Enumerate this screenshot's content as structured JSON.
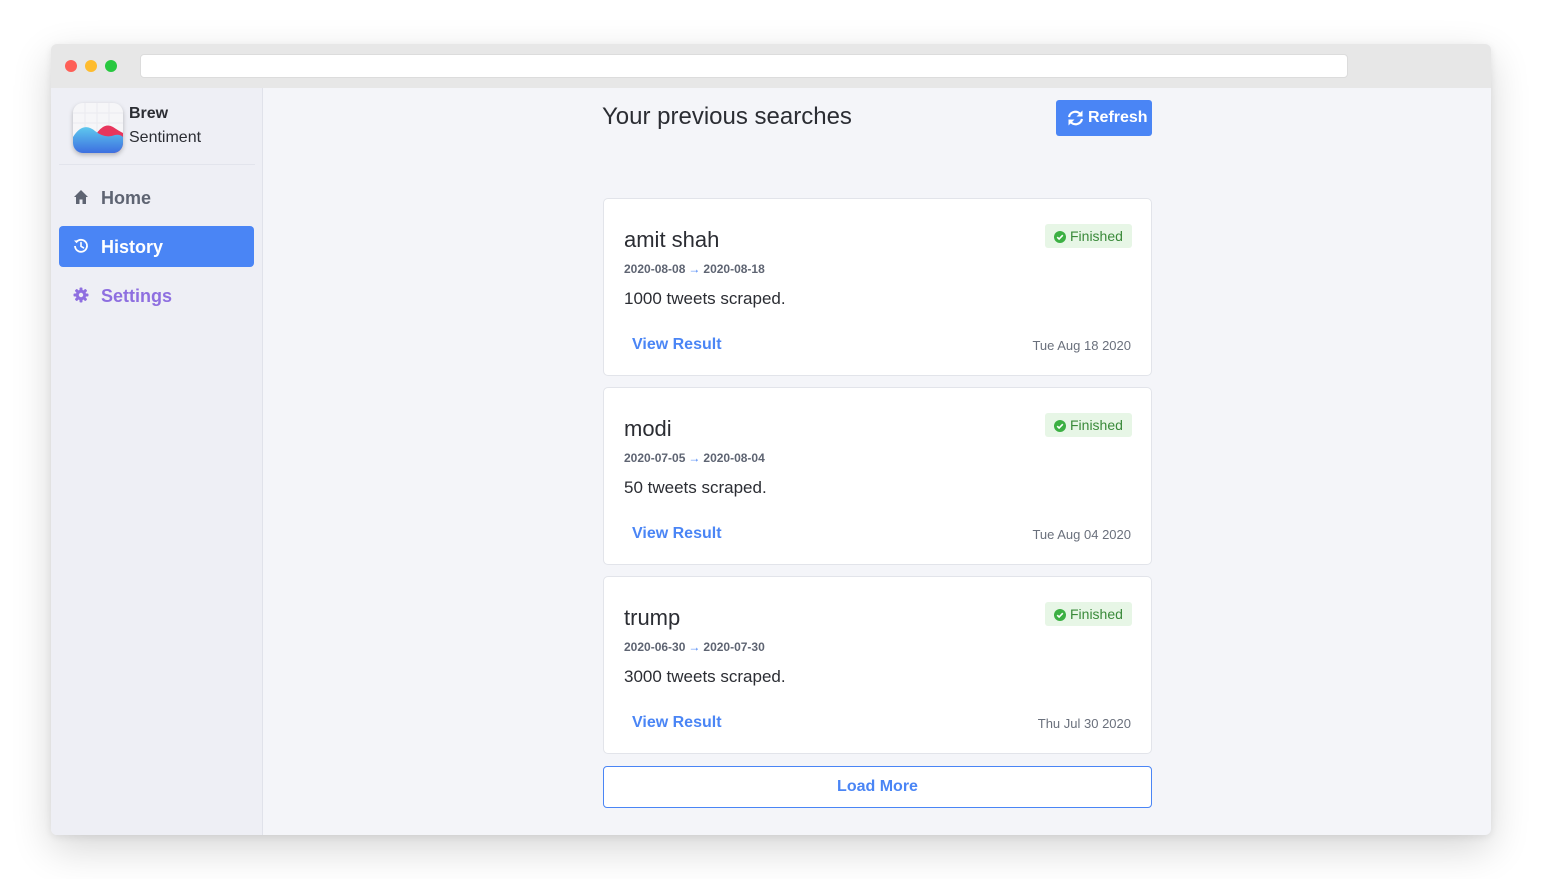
{
  "brand": {
    "name": "Brew",
    "subtitle": "Sentiment"
  },
  "nav": [
    {
      "label": "Home",
      "icon": "home-icon",
      "active": false
    },
    {
      "label": "History",
      "icon": "history-icon",
      "active": true
    },
    {
      "label": "Settings",
      "icon": "gear-icon",
      "active": false
    }
  ],
  "page": {
    "title": "Your previous searches",
    "refresh_label": "Refresh",
    "load_more_label": "Load More"
  },
  "searches": [
    {
      "query": "amit shah",
      "status": "Finished",
      "date_from": "2020-08-08",
      "date_to": "2020-08-18",
      "summary": "1000 tweets scraped.",
      "action_label": "View Result",
      "date": "Tue Aug 18 2020"
    },
    {
      "query": "modi",
      "status": "Finished",
      "date_from": "2020-07-05",
      "date_to": "2020-08-04",
      "summary": "50 tweets scraped.",
      "action_label": "View Result",
      "date": "Tue Aug 04 2020"
    },
    {
      "query": "trump",
      "status": "Finished",
      "date_from": "2020-06-30",
      "date_to": "2020-07-30",
      "summary": "3000 tweets scraped.",
      "action_label": "View Result",
      "date": "Thu Jul 30 2020"
    }
  ],
  "colors": {
    "accent": "#4a85f5",
    "success_bg": "#e7f6e6",
    "success_text": "#3a8a3a",
    "settings_text": "#8e6fe0"
  }
}
